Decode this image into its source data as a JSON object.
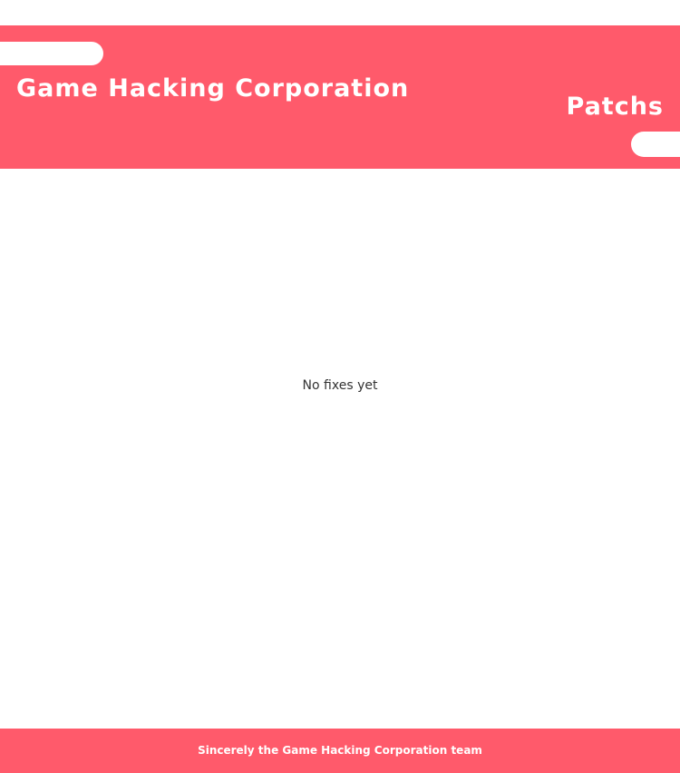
{
  "header": {
    "site_title": "Game Hacking Corporation",
    "page_title": "Patchs"
  },
  "main": {
    "empty_message": "No fixes yet"
  },
  "footer": {
    "text": "Sincerely the Game Hacking Corporation team"
  },
  "colors": {
    "accent": "#ff5a6b",
    "background": "#ffffff",
    "text": "#333333"
  }
}
